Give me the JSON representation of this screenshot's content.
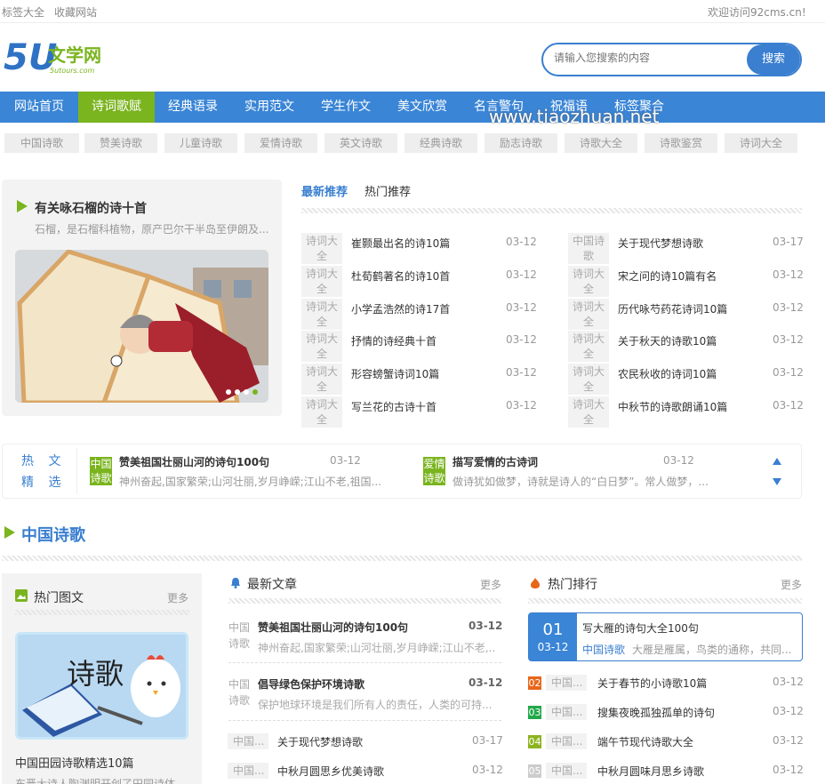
{
  "topbar": {
    "left1": "标签大全",
    "left2": "收藏网站",
    "right": "欢迎访问92cms.cn!"
  },
  "logo": {
    "main": "5U",
    "cn": "文学网",
    "sub": "5utours.com"
  },
  "search": {
    "placeholder": "请输入您搜索的内容",
    "button": "搜索"
  },
  "nav": [
    "网站首页",
    "诗词歌赋",
    "经典语录",
    "实用范文",
    "学生作文",
    "美文欣赏",
    "名言警句",
    "祝福语",
    "标签聚合"
  ],
  "watermark": "www.tiaozhuan.net",
  "tags": [
    "中国诗歌",
    "赞美诗歌",
    "儿童诗歌",
    "爱情诗歌",
    "英文诗歌",
    "经典诗歌",
    "励志诗歌",
    "诗歌大全",
    "诗歌鉴赏",
    "诗词大全"
  ],
  "feature": {
    "title": "有关咏石榴的诗十首",
    "desc": "石榴，是石榴科植物，原产巴尔干半岛至伊朗及..."
  },
  "tabs": {
    "latest": "最新推荐",
    "hot": "热门推荐"
  },
  "latest_left": [
    {
      "cat": "诗词大全",
      "title": "崔颢最出名的诗10篇",
      "date": "03-12"
    },
    {
      "cat": "诗词大全",
      "title": "杜荀鹤著名的诗10首",
      "date": "03-12"
    },
    {
      "cat": "诗词大全",
      "title": "小学孟浩然的诗17首",
      "date": "03-12"
    },
    {
      "cat": "诗词大全",
      "title": "抒情的诗经典十首",
      "date": "03-12"
    },
    {
      "cat": "诗词大全",
      "title": "形容螃蟹诗词10篇",
      "date": "03-12"
    },
    {
      "cat": "诗词大全",
      "title": "写兰花的古诗十首",
      "date": "03-12"
    }
  ],
  "latest_right": [
    {
      "cat": "中国诗歌",
      "title": "关于现代梦想诗歌",
      "date": "03-17"
    },
    {
      "cat": "诗词大全",
      "title": "宋之问的诗10篇有名",
      "date": "03-12"
    },
    {
      "cat": "诗词大全",
      "title": "历代咏芍药花诗词10篇",
      "date": "03-12"
    },
    {
      "cat": "诗词大全",
      "title": "关于秋天的诗歌10篇",
      "date": "03-12"
    },
    {
      "cat": "诗词大全",
      "title": "农民秋收的诗词10篇",
      "date": "03-12"
    },
    {
      "cat": "诗词大全",
      "title": "中秋节的诗歌朗诵10篇",
      "date": "03-12"
    }
  ],
  "hot": {
    "label1": "热 文",
    "label2": "精 选",
    "items": [
      {
        "badge": "中国诗歌",
        "title": "赞美祖国壮丽山河的诗句100句",
        "date": "03-12",
        "desc": "神州奋起,国家繁荣;山河壮丽,岁月峥嵘;江山不老,祖国..."
      },
      {
        "badge": "爱情诗歌",
        "title": "描写爱情的古诗词",
        "date": "03-12",
        "desc": "做诗犹如做梦，诗就是诗人的“白日梦”。常人做梦，..."
      }
    ]
  },
  "section": {
    "title": "中国诗歌"
  },
  "pics": {
    "title": "热门图文",
    "more": "更多",
    "img_text": "诗歌",
    "caption": "中国田园诗歌精选10篇",
    "desc": "东晋大诗人陶渊明开创了田园诗体"
  },
  "newest": {
    "title": "最新文章",
    "more": "更多",
    "items": [
      {
        "cat": "中国诗歌",
        "title": "赞美祖国壮丽山河的诗句100句",
        "date": "03-12",
        "desc": "神州奋起,国家繁荣;山河壮丽,岁月峥嵘;江山不老,..."
      },
      {
        "cat": "中国诗歌",
        "title": "倡导绿色保护环境诗歌",
        "date": "03-12",
        "desc": "保护地球环境是我们所有人的责任，人类的可持..."
      }
    ],
    "list": [
      {
        "cat": "中国...",
        "title": "关于现代梦想诗歌",
        "date": "03-17"
      },
      {
        "cat": "中国...",
        "title": "中秋月圆思乡优美诗歌",
        "date": "03-12"
      }
    ]
  },
  "rank": {
    "title": "热门排行",
    "more": "更多",
    "top": {
      "num": "01",
      "date": "03-12",
      "title": "写大雁的诗句大全100句",
      "cat": "中国诗歌",
      "desc": "大雁是雁属，鸟类的通称，共同..."
    },
    "list": [
      {
        "num": "02",
        "cat": "中国...",
        "title": "关于春节的小诗歌10篇",
        "date": "03-12",
        "color": "#e8661b"
      },
      {
        "num": "03",
        "cat": "中国...",
        "title": "搜集夜晚孤独孤单的诗句",
        "date": "03-12",
        "color": "#22a84a"
      },
      {
        "num": "04",
        "cat": "中国...",
        "title": "端午节现代诗歌大全",
        "date": "03-12",
        "color": "#8db320"
      },
      {
        "num": "05",
        "cat": "中国...",
        "title": "中秋月圆味月思乡诗歌",
        "date": "03-12",
        "color": "#cccccc"
      }
    ]
  },
  "colors": {
    "accent": "#3a85d6",
    "green": "#7ab41e"
  }
}
